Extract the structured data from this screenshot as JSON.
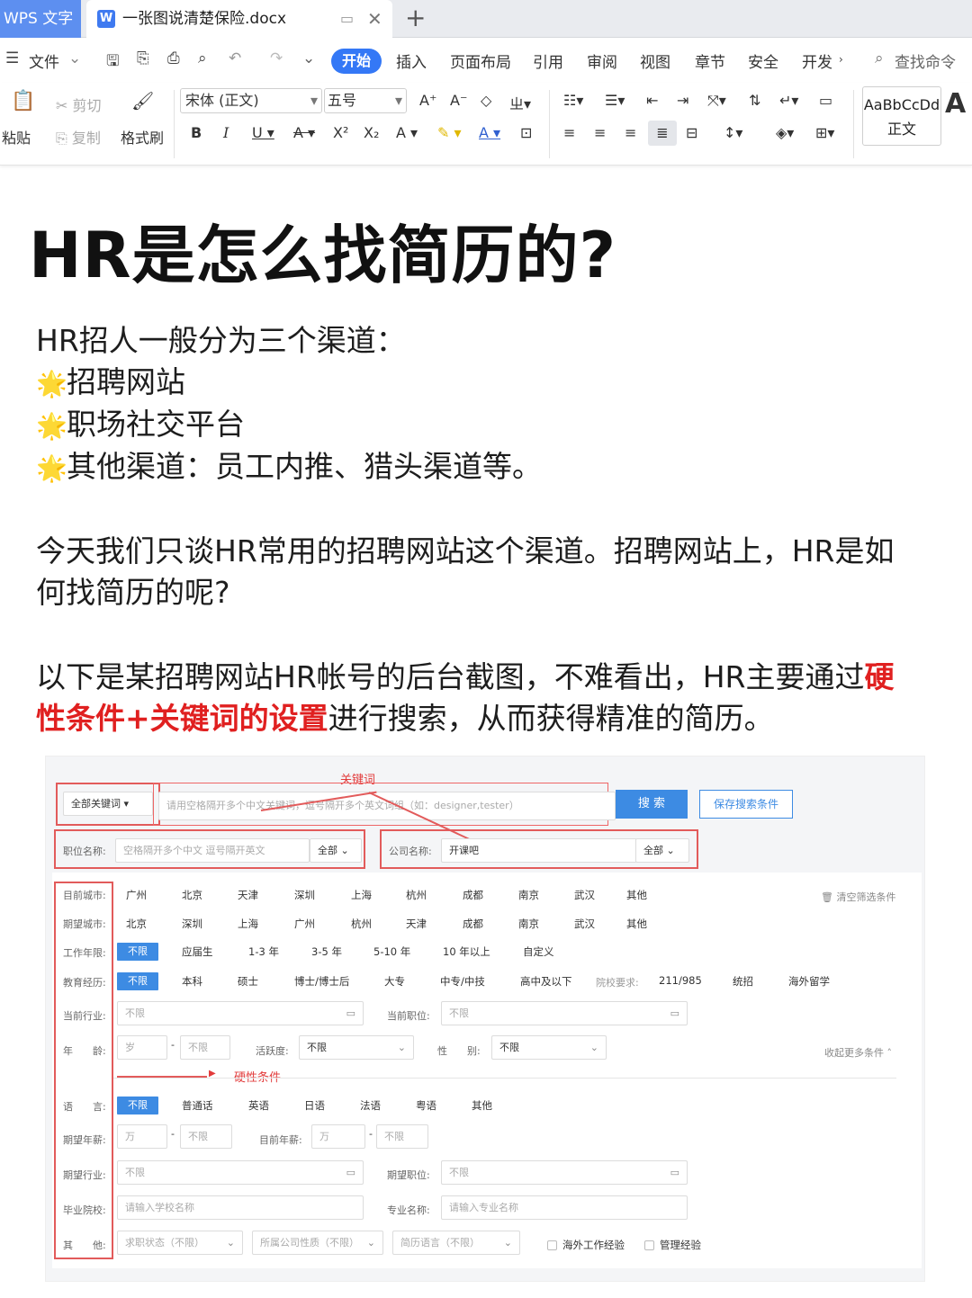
{
  "tabbar": {
    "app_tab": "WPS 文字",
    "doc_tab": "一张图说清楚保险.docx",
    "doc_icon": "W",
    "add_tab": "+"
  },
  "menu": {
    "file": "文件",
    "items": [
      "开始",
      "插入",
      "页面布局",
      "引用",
      "审阅",
      "视图",
      "章节",
      "安全",
      "开发"
    ],
    "search": "查找命令"
  },
  "ribbon": {
    "paste": "粘贴",
    "cut": "剪切",
    "copy": "复制",
    "format_painter": "格式刷",
    "font": "宋体 (正文)",
    "size": "五号",
    "style_preview": "AaBbCcDd",
    "style_name": "正文",
    "style_next": "A"
  },
  "document": {
    "title": "HR是怎么找简历的?",
    "intro": "HR招人一般分为三个渠道：",
    "channels": [
      "招聘网站",
      "职场社交平台",
      "其他渠道：员工内推、猎头渠道等。"
    ],
    "para2_line1": "今天我们只谈HR常用的招聘网站这个渠道。招聘网站上，HR是如",
    "para2_line2": "何找简历的呢?",
    "para3_line1_a": "以下是某招聘网站HR帐号的后台截图，不难看出，HR主要通过",
    "para3_line1_red": "硬",
    "para3_line2_red": "性条件+关键词的设置",
    "para3_line2_b": "进行搜索，从而获得精准的简历。"
  },
  "screenshot": {
    "keyword_annot": "关键词",
    "hard_annot": "硬性条件",
    "keyword_select": "全部关键词",
    "keyword_placeholder": "请用空格隔开多个中文关键词，逗号隔开多个英文词组（如：designer,tester）",
    "search_btn": "搜 索",
    "save_btn": "保存搜索条件",
    "job_label": "职位名称:",
    "job_placeholder": "空格隔开多个中文 逗号隔开英文",
    "job_scope": "全部",
    "company_label": "公司名称:",
    "company_value": "开课吧",
    "company_scope": "全部",
    "clear": "清空筛选条件",
    "collapse": "收起更多条件",
    "current_city_label": "目前城市:",
    "current_cities": [
      "广州",
      "北京",
      "天津",
      "深圳",
      "上海",
      "杭州",
      "成都",
      "南京",
      "武汉",
      "其他"
    ],
    "expect_city_label": "期望城市:",
    "expect_cities": [
      "北京",
      "深圳",
      "上海",
      "广州",
      "杭州",
      "天津",
      "成都",
      "南京",
      "武汉",
      "其他"
    ],
    "years_label": "工作年限:",
    "years": [
      "不限",
      "应届生",
      "1-3 年",
      "3-5 年",
      "5-10 年",
      "10 年以上",
      "自定义"
    ],
    "edu_label": "教育经历:",
    "edu": [
      "不限",
      "本科",
      "硕士",
      "博士/博士后",
      "大专",
      "中专/中技",
      "高中及以下"
    ],
    "school_req_label": "院校要求:",
    "school_req": [
      "211/985",
      "统招",
      "海外留学"
    ],
    "industry_label": "当前行业:",
    "industry_value": "不限",
    "position_label": "当前职位:",
    "position_value": "不限",
    "age_label": "年　　龄:",
    "age_from": "岁",
    "age_to": "不限",
    "active_label": "活跃度:",
    "active_value": "不限",
    "gender_label": "性　　别:",
    "gender_value": "不限",
    "lang_label": "语　　言:",
    "langs": [
      "不限",
      "普通话",
      "英语",
      "日语",
      "法语",
      "粤语",
      "其他"
    ],
    "exp_salary_label": "期望年薪:",
    "exp_salary_from": "万",
    "exp_salary_to": "不限",
    "cur_salary_label": "目前年薪:",
    "cur_salary_from": "万",
    "cur_salary_to": "不限",
    "exp_industry_label": "期望行业:",
    "exp_industry_value": "不限",
    "exp_position_label": "期望职位:",
    "exp_position_value": "不限",
    "school_label": "毕业院校:",
    "school_placeholder": "请输入学校名称",
    "major_label": "专业名称:",
    "major_placeholder": "请输入专业名称",
    "other_label": "其　　他:",
    "other_selects": [
      "求职状态（不限）",
      "所属公司性质（不限）",
      "简历语言（不限）"
    ],
    "checks": [
      "海外工作经验",
      "管理经验"
    ]
  }
}
